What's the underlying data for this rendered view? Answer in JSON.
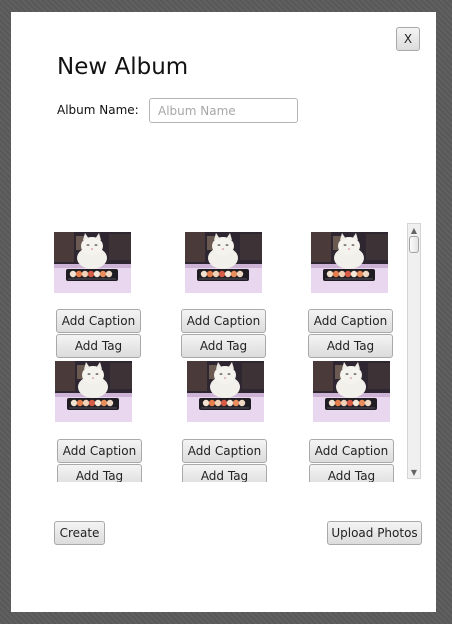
{
  "dialog": {
    "close_label": "X",
    "title": "New Album",
    "album_name_label": "Album Name:",
    "album_name_placeholder": "Album Name",
    "album_name_value": ""
  },
  "photos": [
    {
      "caption_label": "Add Caption",
      "tag_label": "Add Tag"
    },
    {
      "caption_label": "Add Caption",
      "tag_label": "Add Tag"
    },
    {
      "caption_label": "Add Caption",
      "tag_label": "Add Tag"
    },
    {
      "caption_label": "Add Caption",
      "tag_label": "Add Tag"
    },
    {
      "caption_label": "Add Caption",
      "tag_label": "Add Tag"
    },
    {
      "caption_label": "Add Caption",
      "tag_label": "Add Tag"
    }
  ],
  "footer": {
    "create_label": "Create",
    "upload_label": "Upload Photos"
  },
  "scrollbar": {
    "up_icon": "scroll-up-arrow-icon",
    "down_icon": "scroll-down-arrow-icon"
  }
}
